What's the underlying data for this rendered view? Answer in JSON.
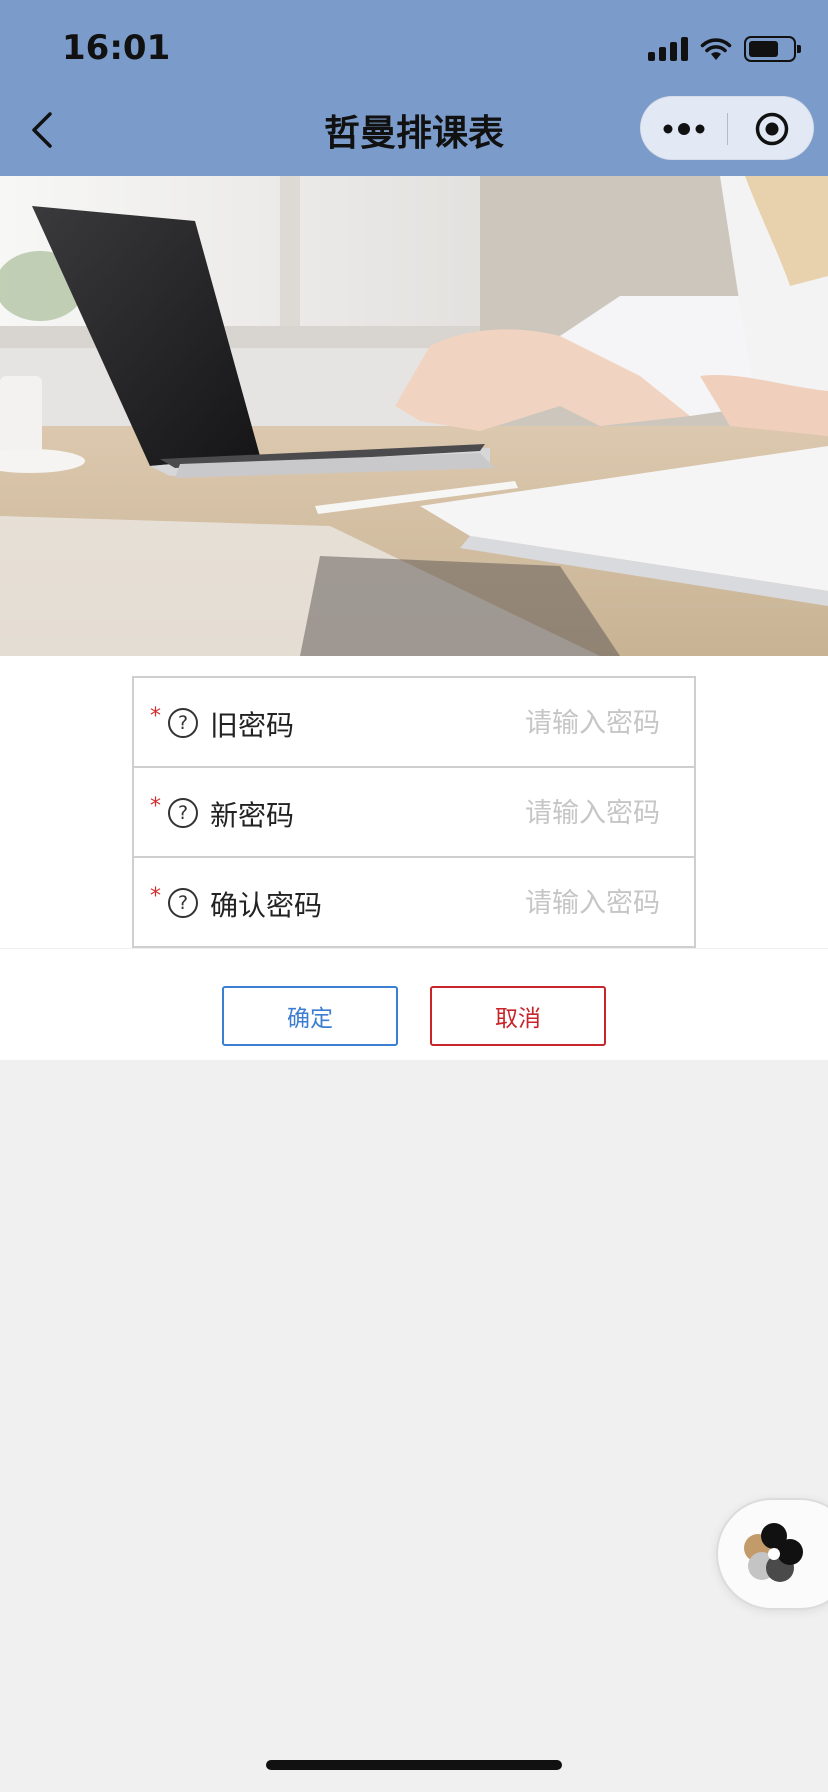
{
  "status_bar": {
    "time": "16:01"
  },
  "nav": {
    "title": "哲曼排课表"
  },
  "form": {
    "rows": [
      {
        "required_mark": "*",
        "help": "?",
        "label": "旧密码",
        "placeholder": "请输入密码",
        "value": ""
      },
      {
        "required_mark": "*",
        "help": "?",
        "label": "新密码",
        "placeholder": "请输入密码",
        "value": ""
      },
      {
        "required_mark": "*",
        "help": "?",
        "label": "确认密码",
        "placeholder": "请输入密码",
        "value": ""
      }
    ]
  },
  "buttons": {
    "confirm": "确定",
    "cancel": "取消"
  },
  "colors": {
    "nav_bg": "#7b9ccb",
    "confirm": "#3d7ed0",
    "cancel": "#c8252a",
    "required": "#d0302f",
    "page_bg": "#f0f0f0"
  },
  "icons": {
    "back": "chevron-left-icon",
    "more": "more-dots-icon",
    "close": "target-circle-icon",
    "help": "question-circle-icon",
    "float": "flower-logo-icon"
  }
}
